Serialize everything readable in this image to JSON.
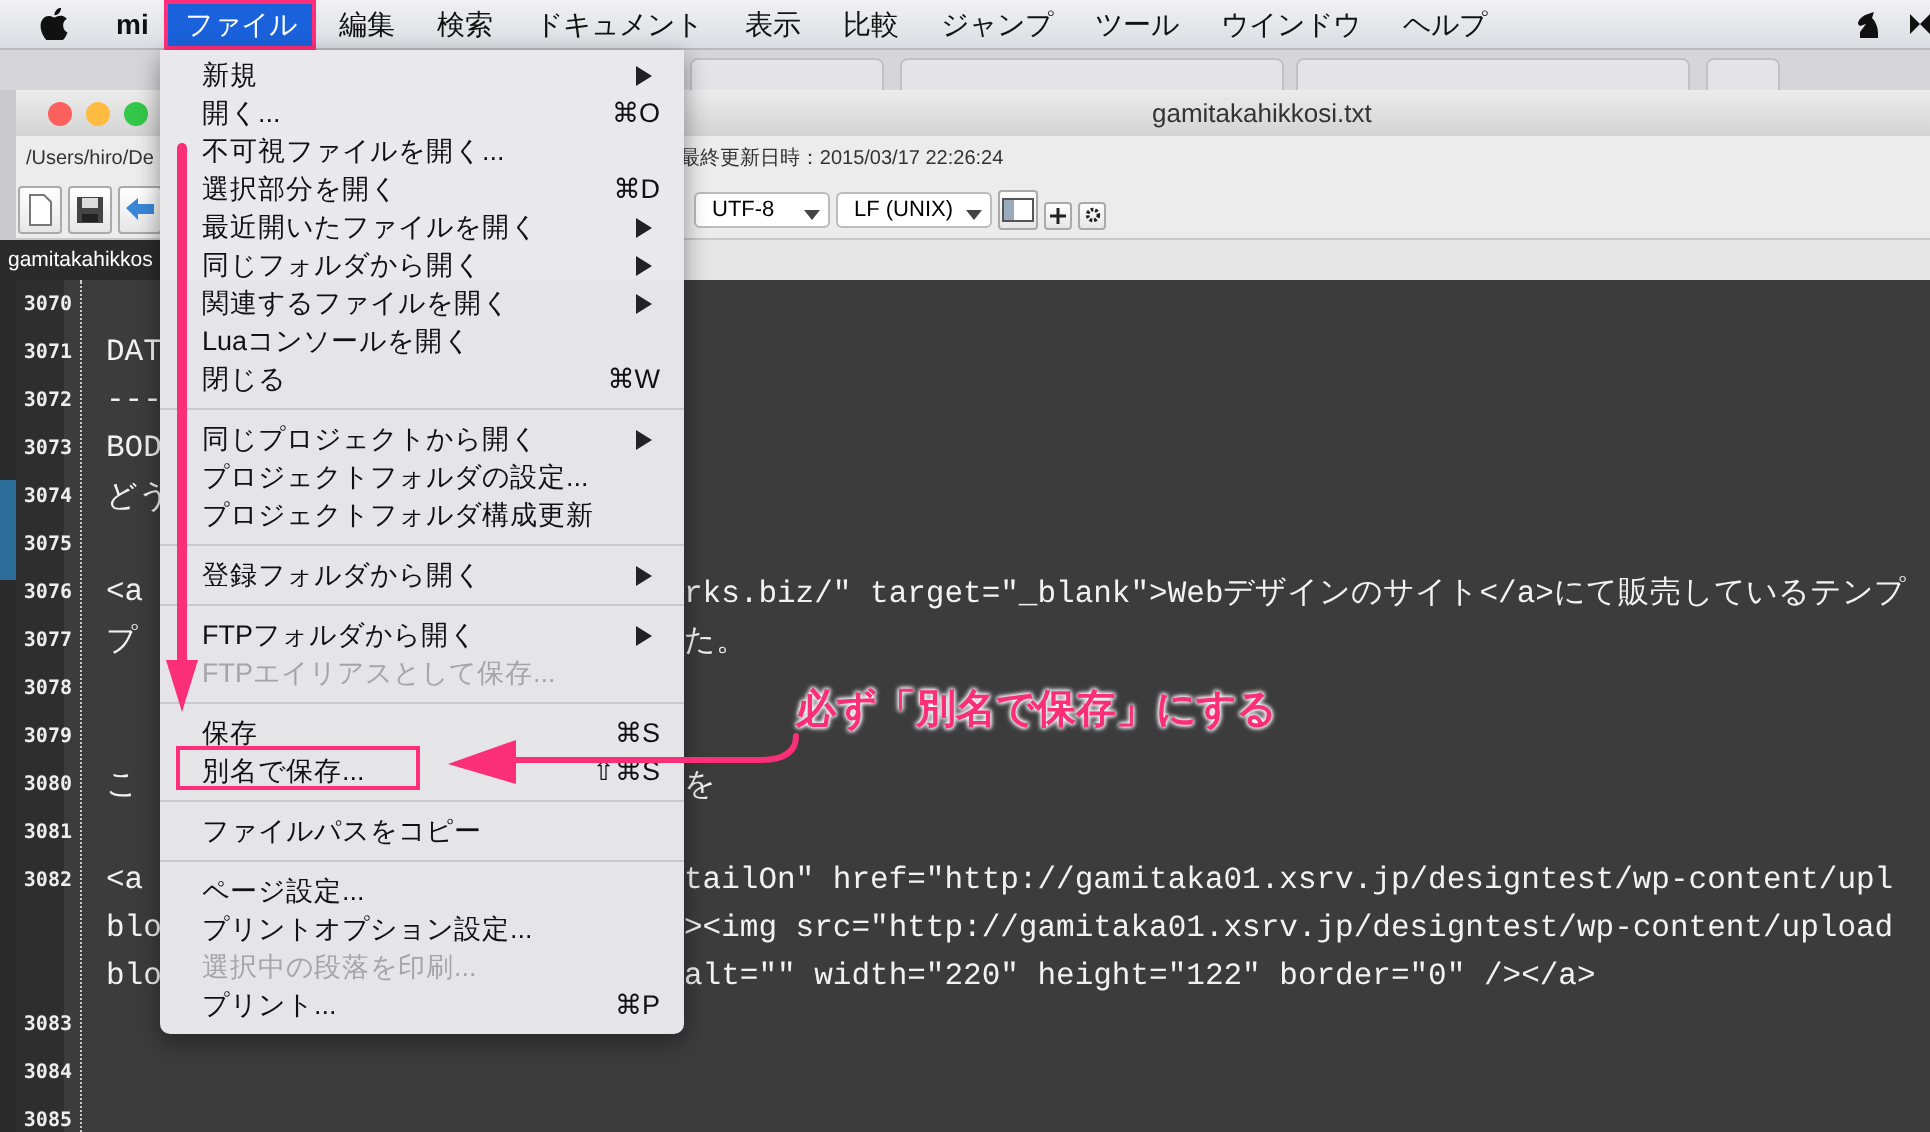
{
  "menubar": {
    "app_name": "mi",
    "menus": [
      {
        "label": "ファイル",
        "selected": true,
        "framed": true
      },
      {
        "label": "編集",
        "selected": false,
        "framed": false
      },
      {
        "label": "検索",
        "selected": false,
        "framed": false
      },
      {
        "label": "ドキュメント",
        "selected": false,
        "framed": false
      },
      {
        "label": "表示",
        "selected": false,
        "framed": false
      },
      {
        "label": "比較",
        "selected": false,
        "framed": false
      },
      {
        "label": "ジャンプ",
        "selected": false,
        "framed": false
      },
      {
        "label": "ツール",
        "selected": false,
        "framed": false
      },
      {
        "label": "ウインドウ",
        "selected": false,
        "framed": false
      },
      {
        "label": "ヘルプ",
        "selected": false,
        "framed": false
      }
    ]
  },
  "window": {
    "title": "gamitakahikkosi.txt",
    "path": "/Users/hiro/De",
    "modified": "最終更新日時：2015/03/17 22:26:24"
  },
  "toolbar": {
    "encoding": "UTF-8",
    "line_ending": "LF (UNIX)"
  },
  "tabs": [
    {
      "label": "gamitakahikkos",
      "selected": true
    }
  ],
  "editor": {
    "lines": [
      {
        "number": "3070"
      },
      {
        "number": "3071",
        "rows": [
          {
            "left": "DAT"
          }
        ]
      },
      {
        "number": "3072",
        "rows": [
          {
            "left": "---"
          }
        ]
      },
      {
        "number": "3073",
        "rows": [
          {
            "left": "BOD"
          }
        ]
      },
      {
        "number": "3074",
        "rows": [
          {
            "left": "どう"
          }
        ]
      },
      {
        "number": "3075"
      },
      {
        "number": "3076",
        "rows": [
          {
            "left": "<a",
            "right": "rks.biz/\" target=\"_blank\">Webデザインのサイト</a>にて販売しているテンプ"
          }
        ]
      },
      {
        "number": "3077",
        "rows": [
          {
            "left": "プ",
            "right": "た。"
          }
        ]
      },
      {
        "number": "3078"
      },
      {
        "number": "3079"
      },
      {
        "number": "3080",
        "rows": [
          {
            "left": "こ",
            "right": "を"
          }
        ]
      },
      {
        "number": "3081"
      },
      {
        "number": "3082",
        "rows": [
          {
            "left": "<a",
            "right": "tailOn\" href=\"http://gamitaka01.xsrv.jp/designtest/wp-content/upl"
          },
          {
            "left": "blo",
            "right": "><img src=\"http://gamitaka01.xsrv.jp/designtest/wp-content/upload"
          },
          {
            "left": "blo",
            "right": "alt=\"\" width=\"220\" height=\"122\" border=\"0\" /></a>"
          }
        ]
      },
      {
        "number": "3083"
      },
      {
        "number": "3084"
      },
      {
        "number": "3085"
      }
    ]
  },
  "file_menu": {
    "items": [
      {
        "kind": "item",
        "label": "新規",
        "submenu": true,
        "disabled": false,
        "framed": false
      },
      {
        "kind": "item",
        "label": "開く...",
        "shortcut": "⌘O",
        "submenu": false,
        "disabled": false,
        "framed": false
      },
      {
        "kind": "item",
        "label": "不可視ファイルを開く...",
        "submenu": false,
        "disabled": false,
        "framed": false
      },
      {
        "kind": "item",
        "label": "選択部分を開く",
        "shortcut": "⌘D",
        "submenu": false,
        "disabled": false,
        "framed": false
      },
      {
        "kind": "item",
        "label": "最近開いたファイルを開く",
        "submenu": true,
        "disabled": false,
        "framed": false
      },
      {
        "kind": "item",
        "label": "同じフォルダから開く",
        "submenu": true,
        "disabled": false,
        "framed": false
      },
      {
        "kind": "item",
        "label": "関連するファイルを開く",
        "submenu": true,
        "disabled": false,
        "framed": false
      },
      {
        "kind": "item",
        "label": "Luaコンソールを開く",
        "submenu": false,
        "disabled": false,
        "framed": false
      },
      {
        "kind": "item",
        "label": "閉じる",
        "shortcut": "⌘W",
        "submenu": false,
        "disabled": false,
        "framed": false
      },
      {
        "kind": "separator"
      },
      {
        "kind": "item",
        "label": "同じプロジェクトから開く",
        "submenu": true,
        "disabled": false,
        "framed": false
      },
      {
        "kind": "item",
        "label": "プロジェクトフォルダの設定...",
        "submenu": false,
        "disabled": false,
        "framed": false
      },
      {
        "kind": "item",
        "label": "プロジェクトフォルダ構成更新",
        "submenu": false,
        "disabled": false,
        "framed": false
      },
      {
        "kind": "separator"
      },
      {
        "kind": "item",
        "label": "登録フォルダから開く",
        "submenu": true,
        "disabled": false,
        "framed": false
      },
      {
        "kind": "separator"
      },
      {
        "kind": "item",
        "label": "FTPフォルダから開く",
        "submenu": true,
        "disabled": false,
        "framed": false
      },
      {
        "kind": "item",
        "label": "FTPエイリアスとして保存...",
        "submenu": false,
        "disabled": true,
        "framed": false
      },
      {
        "kind": "separator"
      },
      {
        "kind": "item",
        "label": "保存",
        "shortcut": "⌘S",
        "submenu": false,
        "disabled": false,
        "framed": false
      },
      {
        "kind": "item",
        "label": "別名で保存...",
        "shortcut": "⇧⌘S",
        "submenu": false,
        "disabled": false,
        "framed": true
      },
      {
        "kind": "separator"
      },
      {
        "kind": "item",
        "label": "ファイルパスをコピー",
        "submenu": false,
        "disabled": false,
        "framed": false
      },
      {
        "kind": "separator"
      },
      {
        "kind": "item",
        "label": "ページ設定...",
        "submenu": false,
        "disabled": false,
        "framed": false
      },
      {
        "kind": "item",
        "label": "プリントオプション設定...",
        "submenu": false,
        "disabled": false,
        "framed": false
      },
      {
        "kind": "item",
        "label": "選択中の段落を印刷...",
        "submenu": false,
        "disabled": true,
        "framed": false
      },
      {
        "kind": "item",
        "label": "プリント...",
        "shortcut": "⌘P",
        "submenu": false,
        "disabled": false,
        "framed": false
      }
    ]
  },
  "callout": {
    "text": "必ず「別名で保存」にする"
  }
}
